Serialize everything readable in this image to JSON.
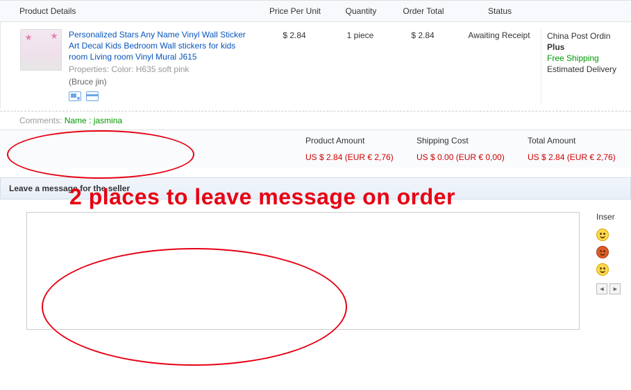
{
  "headers": {
    "details": "Product Details",
    "price": "Price Per Unit",
    "qty": "Quantity",
    "total": "Order Total",
    "status": "Status"
  },
  "product": {
    "title": "Personalized Stars Any Name Vinyl Wall Sticker Art Decal Kids Bedroom Wall stickers for kids room Living room Vinyl Mural J615",
    "properties": "Properties: Color: H635 soft pink",
    "seller": "(Bruce jin)",
    "price": "$ 2.84",
    "qty": "1 piece",
    "total": "$ 2.84",
    "status": "Awaiting Receipt"
  },
  "shipping": {
    "method_line1": "China Post Ordin",
    "method_line2": "Plus",
    "free": "Free Shipping",
    "est": "Estimated Delivery"
  },
  "comments": {
    "label": "Comments:",
    "value": "Name : jasmina"
  },
  "totals": {
    "product_label": "Product Amount",
    "product_value": "US $ 2.84 (EUR € 2,76)",
    "shipping_label": "Shipping Cost",
    "shipping_value": "US $ 0.00 (EUR € 0,00)",
    "total_label": "Total Amount",
    "total_value": "US $ 2.84 (EUR € 2,76)"
  },
  "overlay": "2 places to leave message on order",
  "leave_msg_header": "Leave a message for the seller",
  "emoji_title": "Inser",
  "pager": {
    "prev": "◄",
    "next": "►"
  }
}
